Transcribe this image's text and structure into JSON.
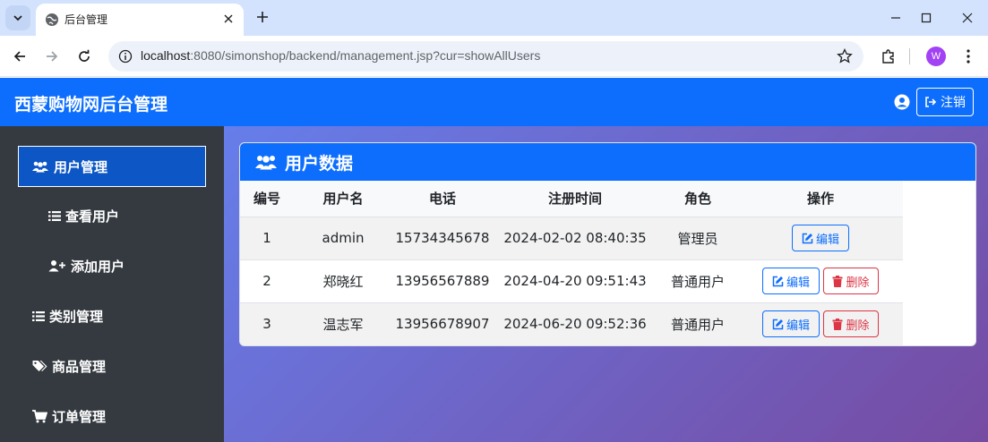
{
  "browser": {
    "tab_title": "后台管理",
    "url_host": "localhost",
    "url_rest": ":8080/simonshop/backend/management.jsp?cur=showAllUsers",
    "profile_initial": "W"
  },
  "header": {
    "brand": "西蒙购物网后台管理",
    "logout_label": "注销"
  },
  "sidebar": {
    "items": [
      {
        "label": "用户管理",
        "icon": "users-icon",
        "active": true
      },
      {
        "label": "查看用户",
        "icon": "list-icon",
        "sub": true
      },
      {
        "label": "添加用户",
        "icon": "user-plus-icon",
        "sub": true
      },
      {
        "label": "类别管理",
        "icon": "list-icon"
      },
      {
        "label": "商品管理",
        "icon": "tags-icon"
      },
      {
        "label": "订单管理",
        "icon": "cart-icon"
      }
    ]
  },
  "card": {
    "title": "用户数据",
    "columns": [
      "编号",
      "用户名",
      "电话",
      "注册时间",
      "角色",
      "操作"
    ],
    "rows": [
      {
        "id": "1",
        "username": "admin",
        "phone": "15734345678",
        "registered": "2024-02-02 08:40:35",
        "role": "管理员"
      },
      {
        "id": "2",
        "username": "郑晓红",
        "phone": "13956567889",
        "registered": "2024-04-20 09:51:43",
        "role": "普通用户"
      },
      {
        "id": "3",
        "username": "温志军",
        "phone": "13956678907",
        "registered": "2024-06-20 09:52:36",
        "role": "普通用户"
      }
    ],
    "edit_label": "编辑",
    "delete_label": "删除"
  },
  "colors": {
    "primary": "#0d6efd",
    "danger": "#dc3545",
    "sidebar_bg": "#343a40",
    "gradient_start": "#667eea",
    "gradient_end": "#764ba2"
  }
}
